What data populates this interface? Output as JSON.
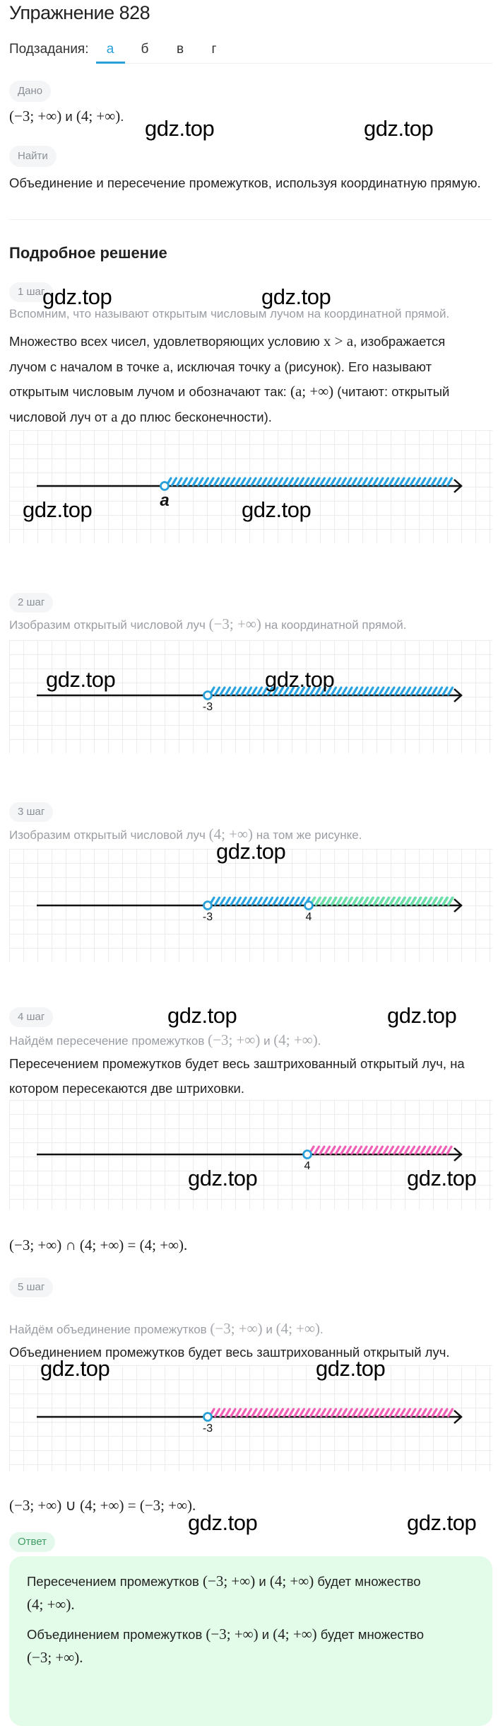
{
  "title": "Упражнение 828",
  "subtasks": {
    "label": "Подзадания:",
    "tabs": [
      "а",
      "б",
      "в",
      "г"
    ],
    "active": 0
  },
  "given": {
    "label": "Дано",
    "text": [
      {
        "t": "(−3; +∞)",
        "m": true
      },
      {
        "t": " и ",
        "m": false
      },
      {
        "t": "(4; +∞)",
        "m": true
      },
      {
        "t": ".",
        "m": false
      }
    ]
  },
  "find": {
    "label": "Найти",
    "text": "Объединение и пересечение промежутков, используя координатную прямую."
  },
  "solution_heading": "Подробное решение",
  "watermark": "gdz.top",
  "colors": {
    "accent": "#2aa0d8",
    "hatch_blue": "#29a3e0",
    "hatch_green": "#6fe3a2",
    "hatch_pink": "#f061b6",
    "answer_bg": "#e3fbe9"
  },
  "steps": [
    {
      "label": "1 шаг",
      "intro": [
        {
          "t": "Вспомним, что называют открытым числовым лучом на координатной прямой.",
          "m": false
        }
      ],
      "paragraphs": [
        [
          {
            "t": "Множество всех чисел, удовлетворяющих условию ",
            "m": false
          },
          {
            "t": "x > a",
            "m": true
          },
          {
            "t": ", изображается",
            "m": false
          }
        ],
        [
          {
            "t": "лучом с началом в точке ",
            "m": false
          },
          {
            "t": "a",
            "m": true
          },
          {
            "t": ", исключая точку ",
            "m": false
          },
          {
            "t": "a",
            "m": true
          },
          {
            "t": " (рисунок). Его называют",
            "m": false
          }
        ],
        [
          {
            "t": "открытым числовым лучом и обозначают так: ",
            "m": false
          },
          {
            "t": "(a; +∞)",
            "m": true
          },
          {
            "t": " (читают: открытый",
            "m": false
          }
        ],
        [
          {
            "t": "числовой луч от ",
            "m": false
          },
          {
            "t": "a",
            "m": true
          },
          {
            "t": " до плюс бесконечности).",
            "m": false
          }
        ]
      ],
      "figure": {
        "rays": [
          {
            "start_label": "a",
            "color": "hatch_blue"
          }
        ],
        "labels": [
          "a"
        ]
      }
    },
    {
      "label": "2 шаг",
      "intro": [
        {
          "t": "Изобразим открытый числовой луч ",
          "m": false
        },
        {
          "t": "(−3; +∞)",
          "m": true
        },
        {
          "t": " на координатной прямой.",
          "m": false
        }
      ],
      "figure": {
        "rays": [
          {
            "start": -3,
            "color": "hatch_blue"
          }
        ],
        "labels": [
          "-3"
        ]
      }
    },
    {
      "label": "3 шаг",
      "intro": [
        {
          "t": "Изобразим открытый числовой луч ",
          "m": false
        },
        {
          "t": "(4; +∞)",
          "m": true
        },
        {
          "t": " на том же рисунке.",
          "m": false
        }
      ],
      "figure": {
        "rays": [
          {
            "start": -3,
            "color": "hatch_blue"
          },
          {
            "start": 4,
            "color": "hatch_green"
          }
        ],
        "labels": [
          "-3",
          "4"
        ]
      }
    },
    {
      "label": "4 шаг",
      "intro": [
        {
          "t": "Найдём пересечение промежутков ",
          "m": false
        },
        {
          "t": "(−3; +∞)",
          "m": true
        },
        {
          "t": " и ",
          "m": false
        },
        {
          "t": "(4; +∞)",
          "m": true
        },
        {
          "t": ".",
          "m": false
        }
      ],
      "paragraphs": [
        [
          {
            "t": "Пересечением промежутков будет весь заштрихованный открытый луч, на",
            "m": false
          }
        ],
        [
          {
            "t": "котором пересекаются две штриховки.",
            "m": false
          }
        ]
      ],
      "figure": {
        "rays": [
          {
            "start": 4,
            "color": "hatch_pink"
          }
        ],
        "labels": [
          "4"
        ]
      },
      "result": [
        {
          "t": "(−3; +∞) ∩ (4; +∞) = (4; +∞).",
          "m": true
        }
      ]
    },
    {
      "label": "5 шаг",
      "intro": [
        {
          "t": "Найдём объединение промежутков ",
          "m": false
        },
        {
          "t": "(−3; +∞)",
          "m": true
        },
        {
          "t": " и ",
          "m": false
        },
        {
          "t": "(4; +∞)",
          "m": true
        },
        {
          "t": ".",
          "m": false
        }
      ],
      "paragraphs": [
        [
          {
            "t": "Объединением промежутков будет весь заштрихованный открытый луч.",
            "m": false
          }
        ]
      ],
      "figure": {
        "rays": [
          {
            "start": -3,
            "color": "hatch_pink"
          }
        ],
        "labels": [
          "-3"
        ]
      },
      "result": [
        {
          "t": "(−3; +∞) ∪ (4; +∞) = (−3; +∞).",
          "m": true
        }
      ]
    }
  ],
  "answer": {
    "label": "Ответ",
    "lines": [
      [
        {
          "t": "Пересечением промежутков ",
          "m": false
        },
        {
          "t": "(−3; +∞)",
          "m": true
        },
        {
          "t": " и ",
          "m": false
        },
        {
          "t": "(4; +∞)",
          "m": true
        },
        {
          "t": " будет множество",
          "m": false
        }
      ],
      [
        {
          "t": "(4; +∞).",
          "m": true
        }
      ],
      [
        {
          "t": "Объединением промежутков ",
          "m": false
        },
        {
          "t": "(−3; +∞)",
          "m": true
        },
        {
          "t": " и ",
          "m": false
        },
        {
          "t": "(4; +∞)",
          "m": true
        },
        {
          "t": " будет множество",
          "m": false
        }
      ],
      [
        {
          "t": "(−3; +∞).",
          "m": true
        }
      ]
    ]
  }
}
